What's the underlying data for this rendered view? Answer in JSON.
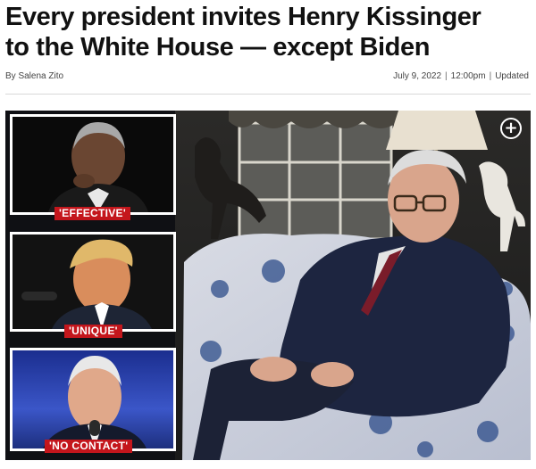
{
  "article": {
    "headline_line1": "Every president invites Henry Kissinger",
    "headline_line2": "to the White House — except Biden",
    "byline": "By Salena Zito",
    "date": "July 9, 2022",
    "time": "12:00pm",
    "updated_label": "Updated"
  },
  "photo": {
    "tags": [
      "'EFFECTIVE'",
      "'UNIQUE'",
      "'NO CONTACT'"
    ],
    "expand_icon": "plus-circle-icon",
    "colors": {
      "tag_bg": "#c4161c",
      "tag_text": "#ffffff"
    }
  }
}
